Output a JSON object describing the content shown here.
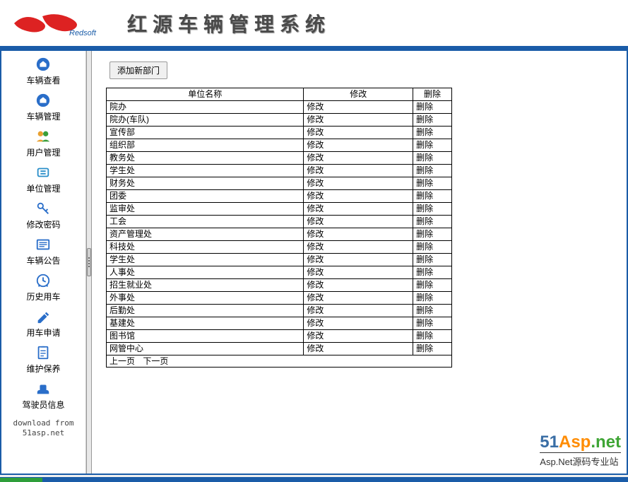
{
  "header": {
    "brand": "Redsoft",
    "title": "红源车辆管理系统"
  },
  "sidebar": {
    "items": [
      {
        "label": "车辆查看",
        "icon": "car-view-icon"
      },
      {
        "label": "车辆管理",
        "icon": "car-manage-icon"
      },
      {
        "label": "用户管理",
        "icon": "users-icon"
      },
      {
        "label": "单位管理",
        "icon": "org-icon"
      },
      {
        "label": "修改密码",
        "icon": "key-icon"
      },
      {
        "label": "车辆公告",
        "icon": "notice-icon"
      },
      {
        "label": "历史用车",
        "icon": "history-icon"
      },
      {
        "label": "用车申请",
        "icon": "request-icon"
      },
      {
        "label": "维护保养",
        "icon": "maintain-icon"
      },
      {
        "label": "驾驶员信息",
        "icon": "driver-icon"
      }
    ],
    "footer_line1": "download from",
    "footer_line2": "51asp.net"
  },
  "content": {
    "add_button": "添加新部门",
    "columns": {
      "name": "单位名称",
      "edit": "修改",
      "del": "删除"
    },
    "edit_label": "修改",
    "del_label": "删除",
    "rows": [
      "院办",
      "院办(车队)",
      "宣传部",
      "组织部",
      "教务处",
      "学生处",
      "财务处",
      "团委",
      "监审处",
      "工会",
      "资产管理处",
      "科技处",
      "学生处",
      "人事处",
      "招生就业处",
      "外事处",
      "后勤处",
      "基建处",
      "图书馆",
      "网管中心"
    ],
    "pager": {
      "prev": "上一页",
      "next": "下一页"
    }
  },
  "footer": {
    "logo_51": "51",
    "logo_asp": "Asp",
    "logo_dotnet": ".net",
    "subtitle": "Asp.Net源码专业站"
  }
}
